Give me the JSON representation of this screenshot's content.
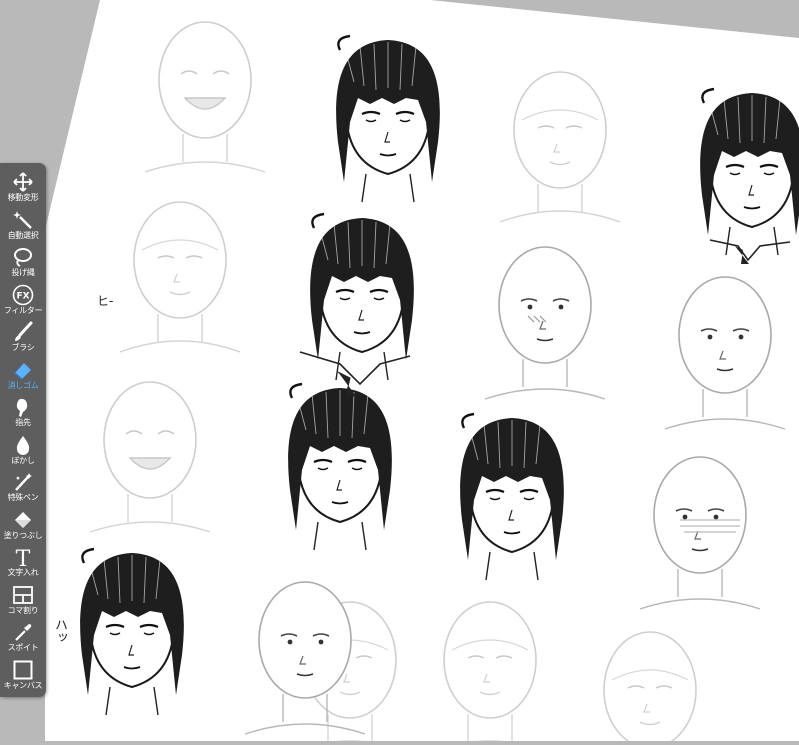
{
  "toolbar": {
    "accent_color": "#5ab2ff",
    "tools": [
      {
        "label": "移動変形",
        "icon": "move-icon"
      },
      {
        "label": "自動選択",
        "icon": "magic-wand-icon"
      },
      {
        "label": "投げ縄",
        "icon": "lasso-icon"
      },
      {
        "label": "フィルター",
        "icon": "fx-icon",
        "icon_text": "FX"
      },
      {
        "label": "ブラシ",
        "icon": "brush-icon"
      },
      {
        "label": "消しゴム",
        "icon": "eraser-icon",
        "active": true
      },
      {
        "label": "指先",
        "icon": "finger-smudge-icon"
      },
      {
        "label": "ぼかし",
        "icon": "blur-drop-icon"
      },
      {
        "label": "特殊ペン",
        "icon": "special-pen-icon"
      },
      {
        "label": "塗りつぶし",
        "icon": "fill-bucket-icon"
      },
      {
        "label": "文字入れ",
        "icon": "text-icon",
        "icon_text": "T"
      },
      {
        "label": "コマ割り",
        "icon": "panel-divide-icon"
      },
      {
        "label": "スポイト",
        "icon": "eyedropper-icon"
      },
      {
        "label": "キャンバス",
        "icon": "canvas-icon"
      }
    ]
  },
  "canvas": {
    "background_color": "#b9b9b9",
    "paper_color": "#ffffff",
    "annotations": [
      {
        "text": "ヒ-"
      },
      {
        "text": "ハッ"
      }
    ]
  }
}
